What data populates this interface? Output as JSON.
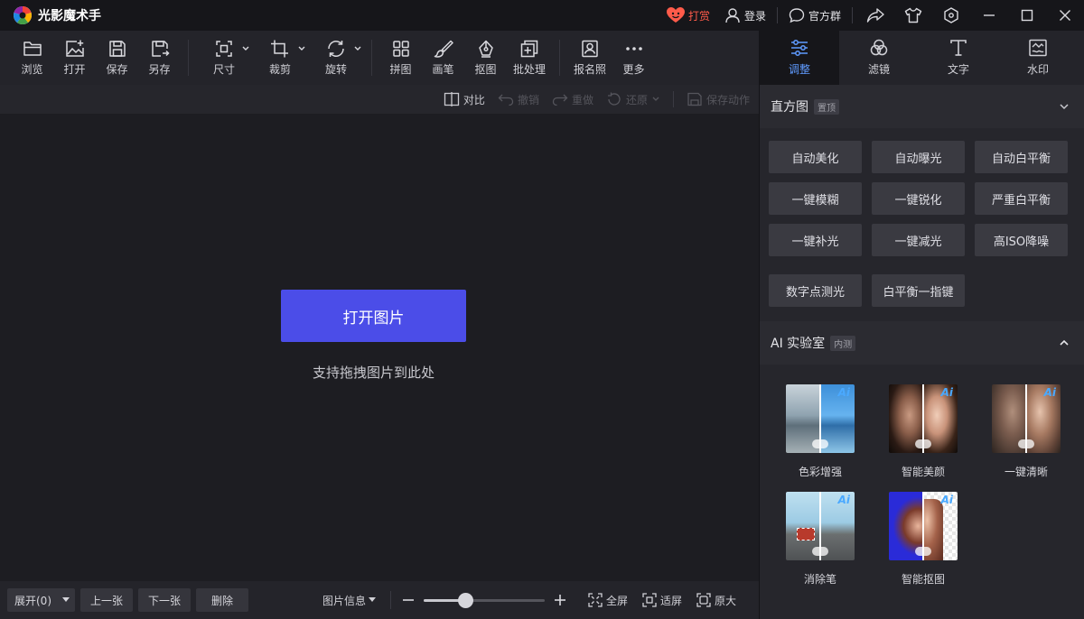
{
  "app": {
    "title": "光影魔术手"
  },
  "titlebar": {
    "reward": "打赏",
    "login": "登录",
    "group": "官方群"
  },
  "toolbar": {
    "browse": "浏览",
    "open": "打开",
    "save": "保存",
    "save_as": "另存",
    "size": "尺寸",
    "crop": "裁剪",
    "rotate": "旋转",
    "collage": "拼图",
    "brush": "画笔",
    "cutout": "抠图",
    "batch": "批处理",
    "id_photo": "报名照",
    "more": "更多"
  },
  "subbar": {
    "compare": "对比",
    "undo": "撤销",
    "redo": "重做",
    "restore": "还原",
    "save_action": "保存动作"
  },
  "canvas": {
    "open_image": "打开图片",
    "drag_hint": "支持拖拽图片到此处"
  },
  "bottombar": {
    "expand": "展开(0)",
    "prev": "上一张",
    "next": "下一张",
    "delete": "删除",
    "image_info": "图片信息",
    "zoom_level": 0.34,
    "fullscreen": "全屏",
    "fit": "适屏",
    "original": "原大"
  },
  "panel": {
    "tabs": [
      {
        "label": "调整"
      },
      {
        "label": "滤镜"
      },
      {
        "label": "文字"
      },
      {
        "label": "水印"
      }
    ],
    "histogram": {
      "title": "直方图",
      "badge": "置顶"
    },
    "adjust_buttons": [
      "自动美化",
      "自动曝光",
      "自动白平衡",
      "一键模糊",
      "一键锐化",
      "严重白平衡",
      "一键补光",
      "一键减光",
      "高ISO降噪",
      "数字点测光",
      "白平衡一指键"
    ],
    "ai_lab": {
      "title": "AI 实验室",
      "badge": "内测",
      "items": [
        {
          "label": "色彩增强",
          "ai_mark": "Ai"
        },
        {
          "label": "智能美颜",
          "ai_mark": "Ai"
        },
        {
          "label": "一键清晰",
          "ai_mark": "Ai"
        },
        {
          "label": "消除笔",
          "ai_mark": "Ai"
        },
        {
          "label": "智能抠图",
          "ai_mark": "Ai"
        }
      ]
    }
  },
  "colors": {
    "accent": "#4b4de8",
    "active_tab": "#5f9bff",
    "reward": "#ff5b4a"
  }
}
